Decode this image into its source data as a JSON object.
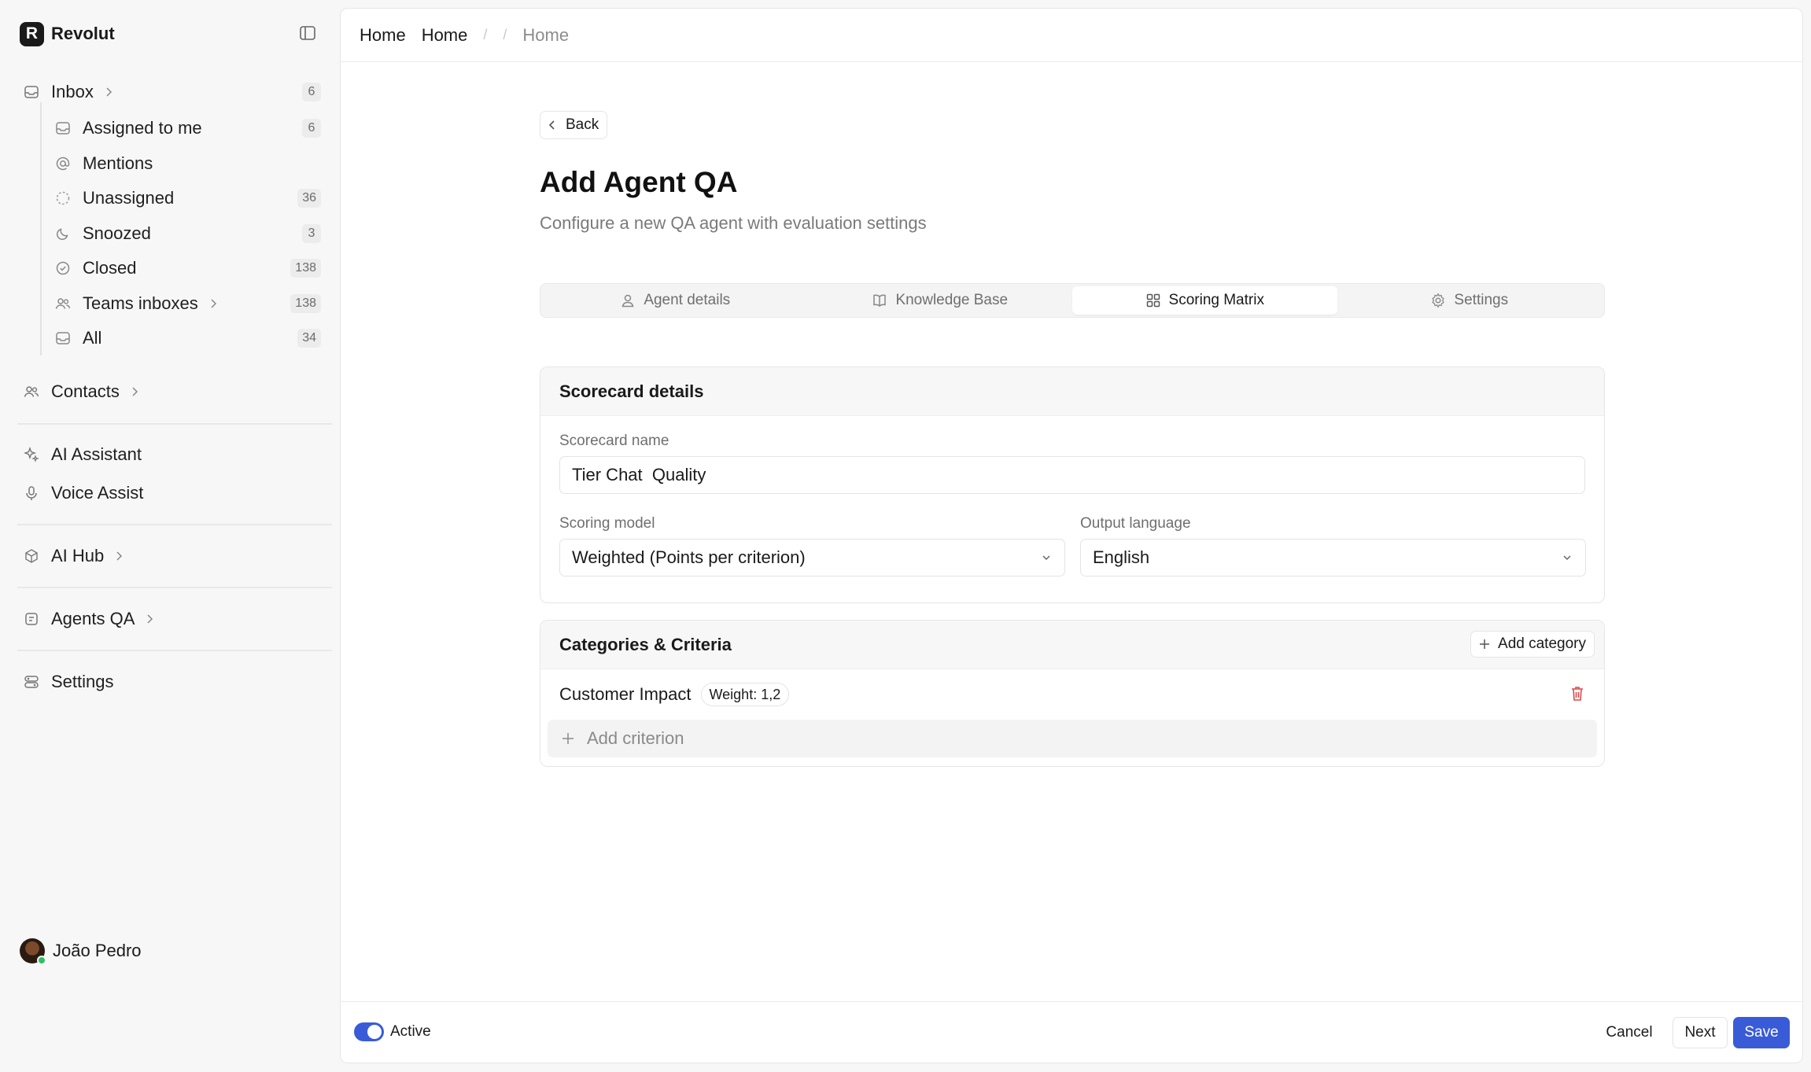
{
  "brand": {
    "logo_letter": "R",
    "name": "Revolut"
  },
  "sidebar": {
    "inbox": {
      "label": "Inbox",
      "count": "6"
    },
    "sub_items": [
      {
        "label": "Assigned to me",
        "count": "6"
      },
      {
        "label": "Mentions",
        "count": ""
      },
      {
        "label": "Unassigned",
        "count": "36"
      },
      {
        "label": "Snoozed",
        "count": "3"
      },
      {
        "label": "Closed",
        "count": "138"
      },
      {
        "label": "Teams inboxes",
        "count": "138"
      },
      {
        "label": "All",
        "count": "34"
      }
    ],
    "contacts": "Contacts",
    "ai_assistant": "AI Assistant",
    "voice_assist": "Voice Assist",
    "ai_hub": "AI Hub",
    "agents_qa": "Agents QA",
    "settings": "Settings",
    "user_name": "João Pedro"
  },
  "breadcrumb": [
    "Home",
    "Home",
    "Home"
  ],
  "back_label": "Back",
  "page": {
    "title": "Add Agent QA",
    "subtitle": "Configure a new QA agent with evaluation settings"
  },
  "tabs": [
    {
      "label": "Agent details",
      "icon": "user-icon",
      "active": false
    },
    {
      "label": "Knowledge Base",
      "icon": "book-icon",
      "active": false
    },
    {
      "label": "Scoring Matrix",
      "icon": "grid-icon",
      "active": true
    },
    {
      "label": "Settings",
      "icon": "gear-icon",
      "active": false
    }
  ],
  "scorecard": {
    "header": "Scorecard details",
    "name_label": "Scorecard name",
    "name_value": "Tier Chat  Quality",
    "model_label": "Scoring model",
    "model_value": "Weighted (Points per criterion)",
    "language_label": "Output language",
    "language_value": "English"
  },
  "categories": {
    "header": "Categories & Criteria",
    "add_category": "Add category",
    "items": [
      {
        "name": "Customer Impact",
        "weight": "Weight: 1,2"
      }
    ],
    "add_criterion": "Add criterion"
  },
  "footer": {
    "active_label": "Active",
    "active": true,
    "cancel": "Cancel",
    "next": "Next",
    "save": "Save"
  },
  "colors": {
    "accent": "#3a5bd8",
    "danger": "#d94a4a"
  }
}
